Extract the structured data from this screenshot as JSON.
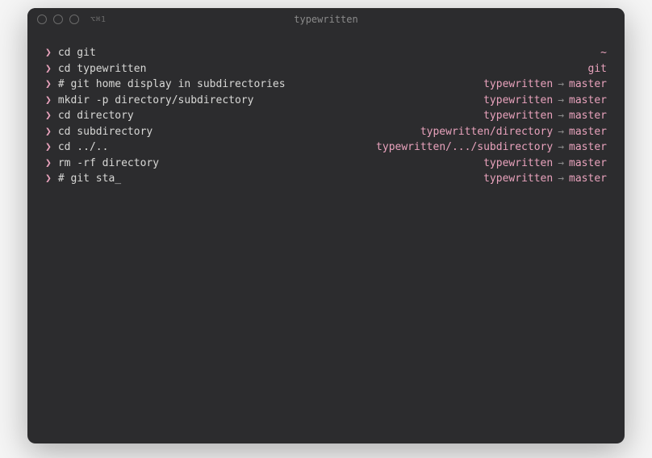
{
  "window": {
    "title": "typewritten",
    "shell_indicator": "⌥⌘1"
  },
  "prompt_symbol": "❯",
  "arrow": "→",
  "cursor": "_",
  "lines": [
    {
      "command": "cd git",
      "right_path": "~",
      "right_branch": ""
    },
    {
      "command": "cd typewritten",
      "right_path": "git",
      "right_branch": ""
    },
    {
      "command": "# git home display in subdirectories",
      "right_path": "typewritten",
      "right_branch": "master"
    },
    {
      "command": "mkdir -p directory/subdirectory",
      "right_path": "typewritten",
      "right_branch": "master"
    },
    {
      "command": "cd directory",
      "right_path": "typewritten",
      "right_branch": "master"
    },
    {
      "command": "cd subdirectory",
      "right_path": "typewritten/directory",
      "right_branch": "master"
    },
    {
      "command": "cd ../..",
      "right_path": "typewritten/.../subdirectory",
      "right_branch": "master"
    },
    {
      "command": "rm -rf directory",
      "right_path": "typewritten",
      "right_branch": "master"
    },
    {
      "command": "# git sta",
      "right_path": "typewritten",
      "right_branch": "master",
      "has_cursor": true
    }
  ]
}
